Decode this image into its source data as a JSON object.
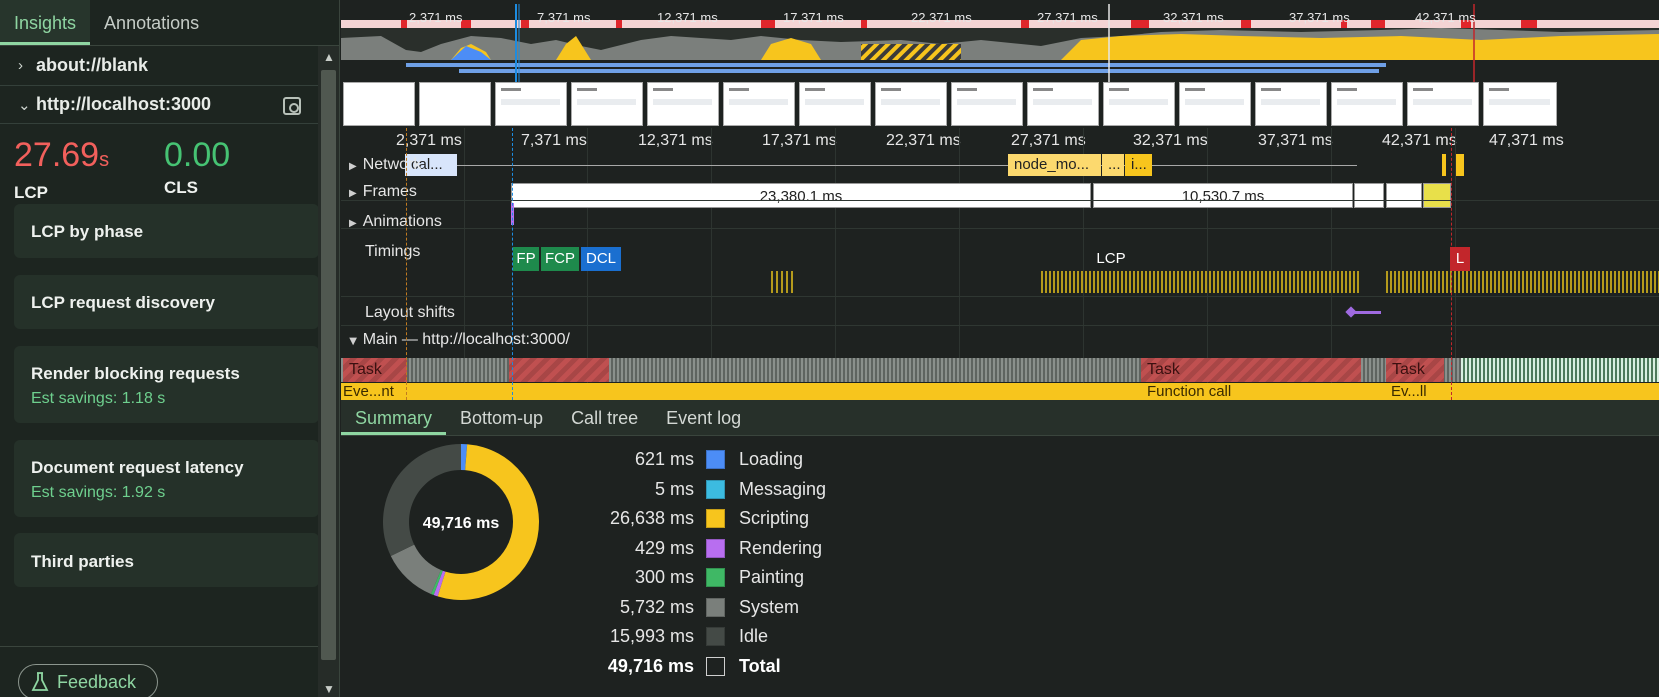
{
  "sidebar": {
    "tabs": [
      "Insights",
      "Annotations"
    ],
    "nav": [
      {
        "label": "about://blank"
      },
      {
        "label": "http://localhost:3000"
      }
    ],
    "metrics": {
      "lcp": {
        "value": "27.69",
        "unit": "s",
        "label": "LCP"
      },
      "cls": {
        "value": "0.00",
        "label": "CLS"
      }
    },
    "insights": [
      {
        "title": "LCP by phase",
        "savings": ""
      },
      {
        "title": "LCP request discovery",
        "savings": ""
      },
      {
        "title": "Render blocking requests",
        "savings": "Est savings: 1.18 s"
      },
      {
        "title": "Document request latency",
        "savings": "Est savings: 1.92 s"
      },
      {
        "title": "Third parties",
        "savings": ""
      }
    ],
    "feedback_label": "Feedback"
  },
  "overview": {
    "ticks": [
      "2,371 ms",
      "7,371 ms",
      "12,371 ms",
      "17,371 ms",
      "22,371 ms",
      "27,371 ms",
      "32,371 ms",
      "37,371 ms",
      "42,371 ms"
    ]
  },
  "ruler": {
    "ticks": [
      "2,371 ms",
      "7,371 ms",
      "12,371 ms",
      "17,371 ms",
      "22,371 ms",
      "27,371 ms",
      "32,371 ms",
      "37,371 ms",
      "42,371 ms",
      "47,371 ms"
    ]
  },
  "tracks": {
    "network": "Network",
    "network_bar_1": "cal...",
    "network_bar_2": "node_mo...",
    "network_bar_3": "...",
    "network_bar_4": "i...",
    "frames": "Frames",
    "frame_1": "23,380.1 ms",
    "frame_2": "10,530.7 ms",
    "animations": "Animations",
    "timings": "Timings",
    "timing_marks": [
      "FP",
      "FCP",
      "DCL",
      "LCP",
      "L"
    ],
    "layout_shifts": "Layout shifts",
    "main": "Main — http://localhost:3000/",
    "task_labels": [
      "Task",
      "Task",
      "Task"
    ],
    "fn_labels": [
      "Eve...nt",
      "Function call",
      "Ev...ll"
    ]
  },
  "bottom": {
    "tabs": [
      "Summary",
      "Bottom-up",
      "Call tree",
      "Event log"
    ],
    "donut_center": "49,716 ms",
    "rows": [
      {
        "value": "621 ms",
        "name": "Loading",
        "color": "#4c8df6"
      },
      {
        "value": "5 ms",
        "name": "Messaging",
        "color": "#3cbbe0"
      },
      {
        "value": "26,638 ms",
        "name": "Scripting",
        "color": "#f7c51d"
      },
      {
        "value": "429 ms",
        "name": "Rendering",
        "color": "#b86ef0"
      },
      {
        "value": "300 ms",
        "name": "Painting",
        "color": "#3fb865"
      },
      {
        "value": "5,732 ms",
        "name": "System",
        "color": "#7a7f7b"
      },
      {
        "value": "15,993 ms",
        "name": "Idle",
        "color": "#444a46"
      },
      {
        "value": "49,716 ms",
        "name": "Total",
        "color": ""
      }
    ]
  }
}
